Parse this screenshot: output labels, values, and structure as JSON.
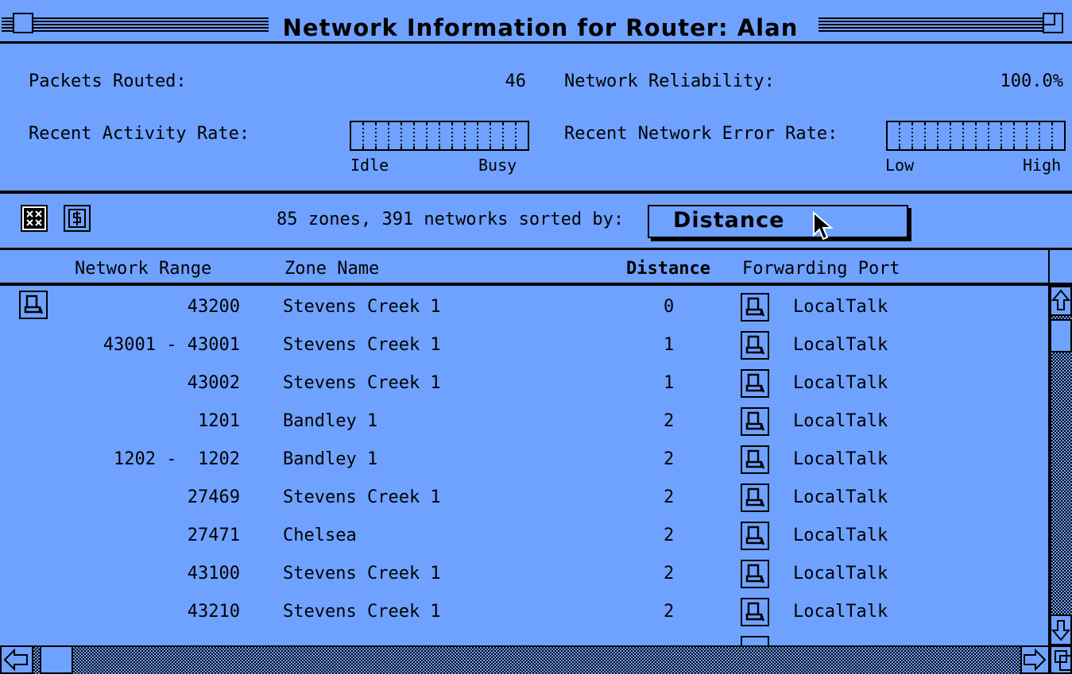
{
  "window": {
    "title": "Network Information for Router: Alan"
  },
  "stats": {
    "packets_label": "Packets Routed:",
    "packets_value": "46",
    "reliability_label": "Network Reliability:",
    "reliability_value": "100.0%",
    "activity_label": "Recent Activity Rate:",
    "activity_low": "Idle",
    "activity_high": "Busy",
    "error_label": "Recent Network Error Rate:",
    "error_low": "Low",
    "error_high": "High"
  },
  "toolbar": {
    "summary": "85 zones, 391 networks sorted by:",
    "sort_value": "Distance"
  },
  "columns": {
    "range": "Network Range",
    "zone": "Zone Name",
    "distance": "Distance",
    "port": "Forwarding Port"
  },
  "rows": [
    {
      "range": "43200",
      "zone": "Stevens Creek 1",
      "distance": "0",
      "port": "LocalTalk",
      "icon": "local-network-icon"
    },
    {
      "range": "43001 - 43001",
      "zone": "Stevens Creek 1",
      "distance": "1",
      "port": "LocalTalk"
    },
    {
      "range": "43002",
      "zone": "Stevens Creek 1",
      "distance": "1",
      "port": "LocalTalk"
    },
    {
      "range": "1201",
      "zone": "Bandley 1",
      "distance": "2",
      "port": "LocalTalk"
    },
    {
      "range": "1202 -  1202",
      "zone": "Bandley 1",
      "distance": "2",
      "port": "LocalTalk"
    },
    {
      "range": "27469",
      "zone": "Stevens Creek 1",
      "distance": "2",
      "port": "LocalTalk"
    },
    {
      "range": "27471",
      "zone": "Chelsea",
      "distance": "2",
      "port": "LocalTalk"
    },
    {
      "range": "43100",
      "zone": "Stevens Creek 1",
      "distance": "2",
      "port": "LocalTalk"
    },
    {
      "range": "43210",
      "zone": "Stevens Creek 1",
      "distance": "2",
      "port": "LocalTalk"
    }
  ],
  "colors": {
    "background": "#6fa2ff",
    "ink": "#000000"
  },
  "icons": [
    "close-box-icon",
    "zoom-box-icon",
    "zones-icon",
    "dollar-icon",
    "localtalk-port-icon",
    "arrow-pointer-icon",
    "scroll-up-icon",
    "scroll-down-icon",
    "scroll-left-icon",
    "scroll-right-icon"
  ]
}
